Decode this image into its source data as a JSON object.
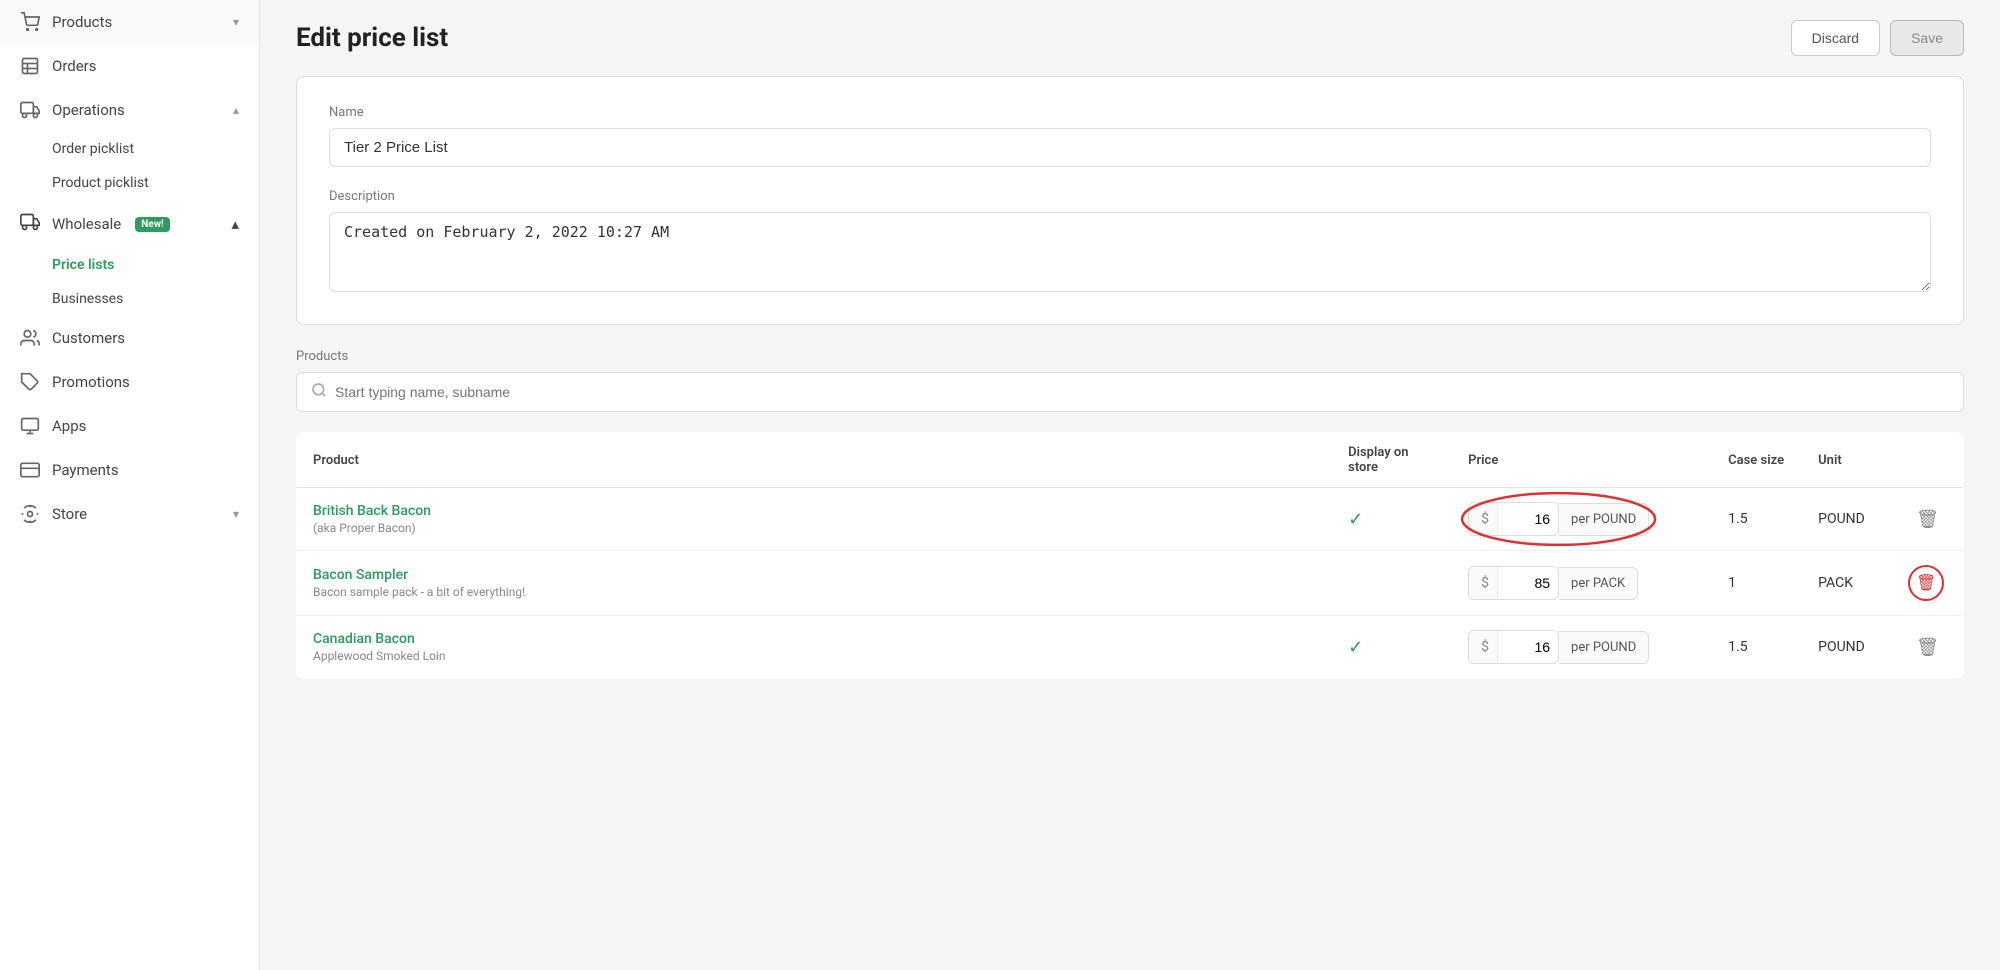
{
  "sidebar": {
    "items": [
      {
        "id": "products",
        "label": "Products",
        "icon": "🛒",
        "hasChevron": true,
        "chevronDown": true
      },
      {
        "id": "orders",
        "label": "Orders",
        "icon": "📋",
        "hasChevron": false
      },
      {
        "id": "operations",
        "label": "Operations",
        "icon": "🚐",
        "hasChevron": true,
        "chevronUp": true
      },
      {
        "id": "order-picklist",
        "label": "Order picklist",
        "sub": true
      },
      {
        "id": "product-picklist",
        "label": "Product picklist",
        "sub": true
      },
      {
        "id": "wholesale",
        "label": "Wholesale",
        "icon": "🚚",
        "hasChevron": true,
        "chevronUp": true,
        "hasNew": true
      },
      {
        "id": "price-lists",
        "label": "Price lists",
        "sub": true,
        "active": true
      },
      {
        "id": "businesses",
        "label": "Businesses",
        "sub": true
      },
      {
        "id": "customers",
        "label": "Customers",
        "icon": "👥",
        "hasChevron": false
      },
      {
        "id": "promotions",
        "label": "Promotions",
        "icon": "🏷",
        "hasChevron": false
      },
      {
        "id": "apps",
        "label": "Apps",
        "icon": "🖥",
        "hasChevron": false
      },
      {
        "id": "payments",
        "label": "Payments",
        "icon": "💳",
        "hasChevron": false
      },
      {
        "id": "store",
        "label": "Store",
        "icon": "⚙",
        "hasChevron": true,
        "chevronDown": true
      }
    ]
  },
  "header": {
    "title": "Edit price list",
    "discard_label": "Discard",
    "save_label": "Save"
  },
  "form": {
    "name_label": "Name",
    "name_value": "Tier 2 Price List",
    "description_label": "Description",
    "description_value": "Created on February 2, 2022 10:27 AM",
    "products_label": "Products",
    "search_placeholder": "Start typing name, subname"
  },
  "table": {
    "columns": [
      "Product",
      "Display on store",
      "Price",
      "Case size",
      "Unit"
    ],
    "rows": [
      {
        "name": "British Back Bacon",
        "sub": "(aka Proper Bacon)",
        "display_on_store": true,
        "price": "16",
        "per_unit": "per POUND",
        "case_size": "1.5",
        "unit": "POUND",
        "highlighted": true,
        "delete_circle": false
      },
      {
        "name": "Bacon Sampler",
        "sub": "Bacon sample pack - a bit of everything!",
        "display_on_store": false,
        "price": "85",
        "per_unit": "per PACK",
        "case_size": "1",
        "unit": "PACK",
        "highlighted": false,
        "delete_circle": true
      },
      {
        "name": "Canadian Bacon",
        "sub": "Applewood Smoked Loin",
        "display_on_store": true,
        "price": "16",
        "per_unit": "per POUND",
        "case_size": "1.5",
        "unit": "POUND",
        "highlighted": false,
        "delete_circle": false
      }
    ]
  }
}
